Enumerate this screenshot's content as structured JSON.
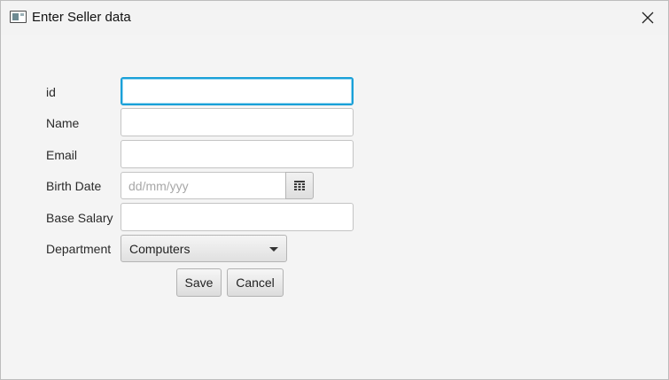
{
  "window": {
    "title": "Enter Seller data"
  },
  "form": {
    "id": {
      "label": "id",
      "value": ""
    },
    "name": {
      "label": "Name",
      "value": ""
    },
    "email": {
      "label": "Email",
      "value": ""
    },
    "birth_date": {
      "label": "Birth Date",
      "value": "",
      "placeholder": "dd/mm/yyy"
    },
    "base_salary": {
      "label": "Base Salary",
      "value": ""
    },
    "department": {
      "label": "Department",
      "selected": "Computers"
    }
  },
  "buttons": {
    "save": "Save",
    "cancel": "Cancel"
  },
  "colors": {
    "focus_border": "#1aa0d8",
    "background": "#f4f4f4"
  }
}
